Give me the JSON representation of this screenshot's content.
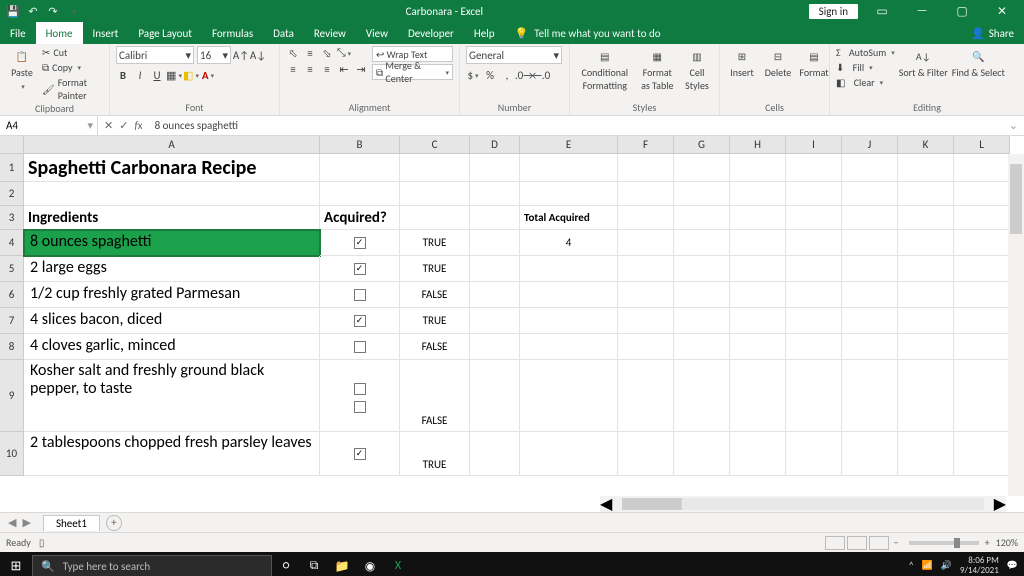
{
  "title": "Carbonara  -  Excel",
  "signin": "Sign in",
  "share": "Share",
  "tabs": [
    "File",
    "Home",
    "Insert",
    "Page Layout",
    "Formulas",
    "Data",
    "Review",
    "View",
    "Developer",
    "Help"
  ],
  "tellme": "Tell me what you want to do",
  "clipboard": {
    "paste": "Paste",
    "cut": "Cut",
    "copy": "Copy",
    "painter": "Format Painter",
    "label": "Clipboard"
  },
  "font": {
    "name": "Calibri",
    "size": "16",
    "label": "Font"
  },
  "alignment": {
    "wrap": "Wrap Text",
    "merge": "Merge & Center",
    "label": "Alignment"
  },
  "number": {
    "format": "General",
    "label": "Number"
  },
  "styles": {
    "cond": "Conditional Formatting",
    "fat": "Format as Table",
    "cell": "Cell Styles",
    "label": "Styles"
  },
  "cells_grp": {
    "ins": "Insert",
    "del": "Delete",
    "fmt": "Format",
    "label": "Cells"
  },
  "editing": {
    "autosum": "AutoSum",
    "fill": "Fill",
    "clear": "Clear",
    "sort": "Sort & Filter",
    "find": "Find & Select",
    "label": "Editing"
  },
  "namebox": "A4",
  "formula": "8 ounces spaghetti",
  "cols": [
    "A",
    "B",
    "C",
    "D",
    "E",
    "F",
    "G",
    "H",
    "I",
    "J",
    "K",
    "L"
  ],
  "rowNums": [
    "1",
    "2",
    "3",
    "4",
    "5",
    "6",
    "7",
    "8",
    "9",
    "10"
  ],
  "sheet": {
    "title": "Spaghetti Carbonara Recipe",
    "ing_hdr": "Ingredients",
    "acq_hdr": "Acquired?",
    "total_hdr": "Total Acquired",
    "total_val": "4",
    "rows": [
      {
        "a": "8 ounces spaghetti",
        "chk": true,
        "c": "TRUE"
      },
      {
        "a": "2 large eggs",
        "chk": true,
        "c": "TRUE"
      },
      {
        "a": "1/2 cup freshly grated Parmesan",
        "chk": false,
        "c": "FALSE"
      },
      {
        "a": "4 slices bacon, diced",
        "chk": true,
        "c": "TRUE"
      },
      {
        "a": "4 cloves garlic, minced",
        "chk": false,
        "c": "FALSE"
      },
      {
        "a": "Kosher salt and freshly ground black pepper, to taste",
        "chk": false,
        "c": "FALSE"
      },
      {
        "a": "2 tablespoons chopped fresh parsley leaves",
        "chk": true,
        "c": "TRUE"
      }
    ]
  },
  "sheet_tab": "Sheet1",
  "status": "Ready",
  "zoom": "120%",
  "taskbar": {
    "search": "Type here to search",
    "time": "8:06 PM",
    "date": "9/14/2021"
  }
}
